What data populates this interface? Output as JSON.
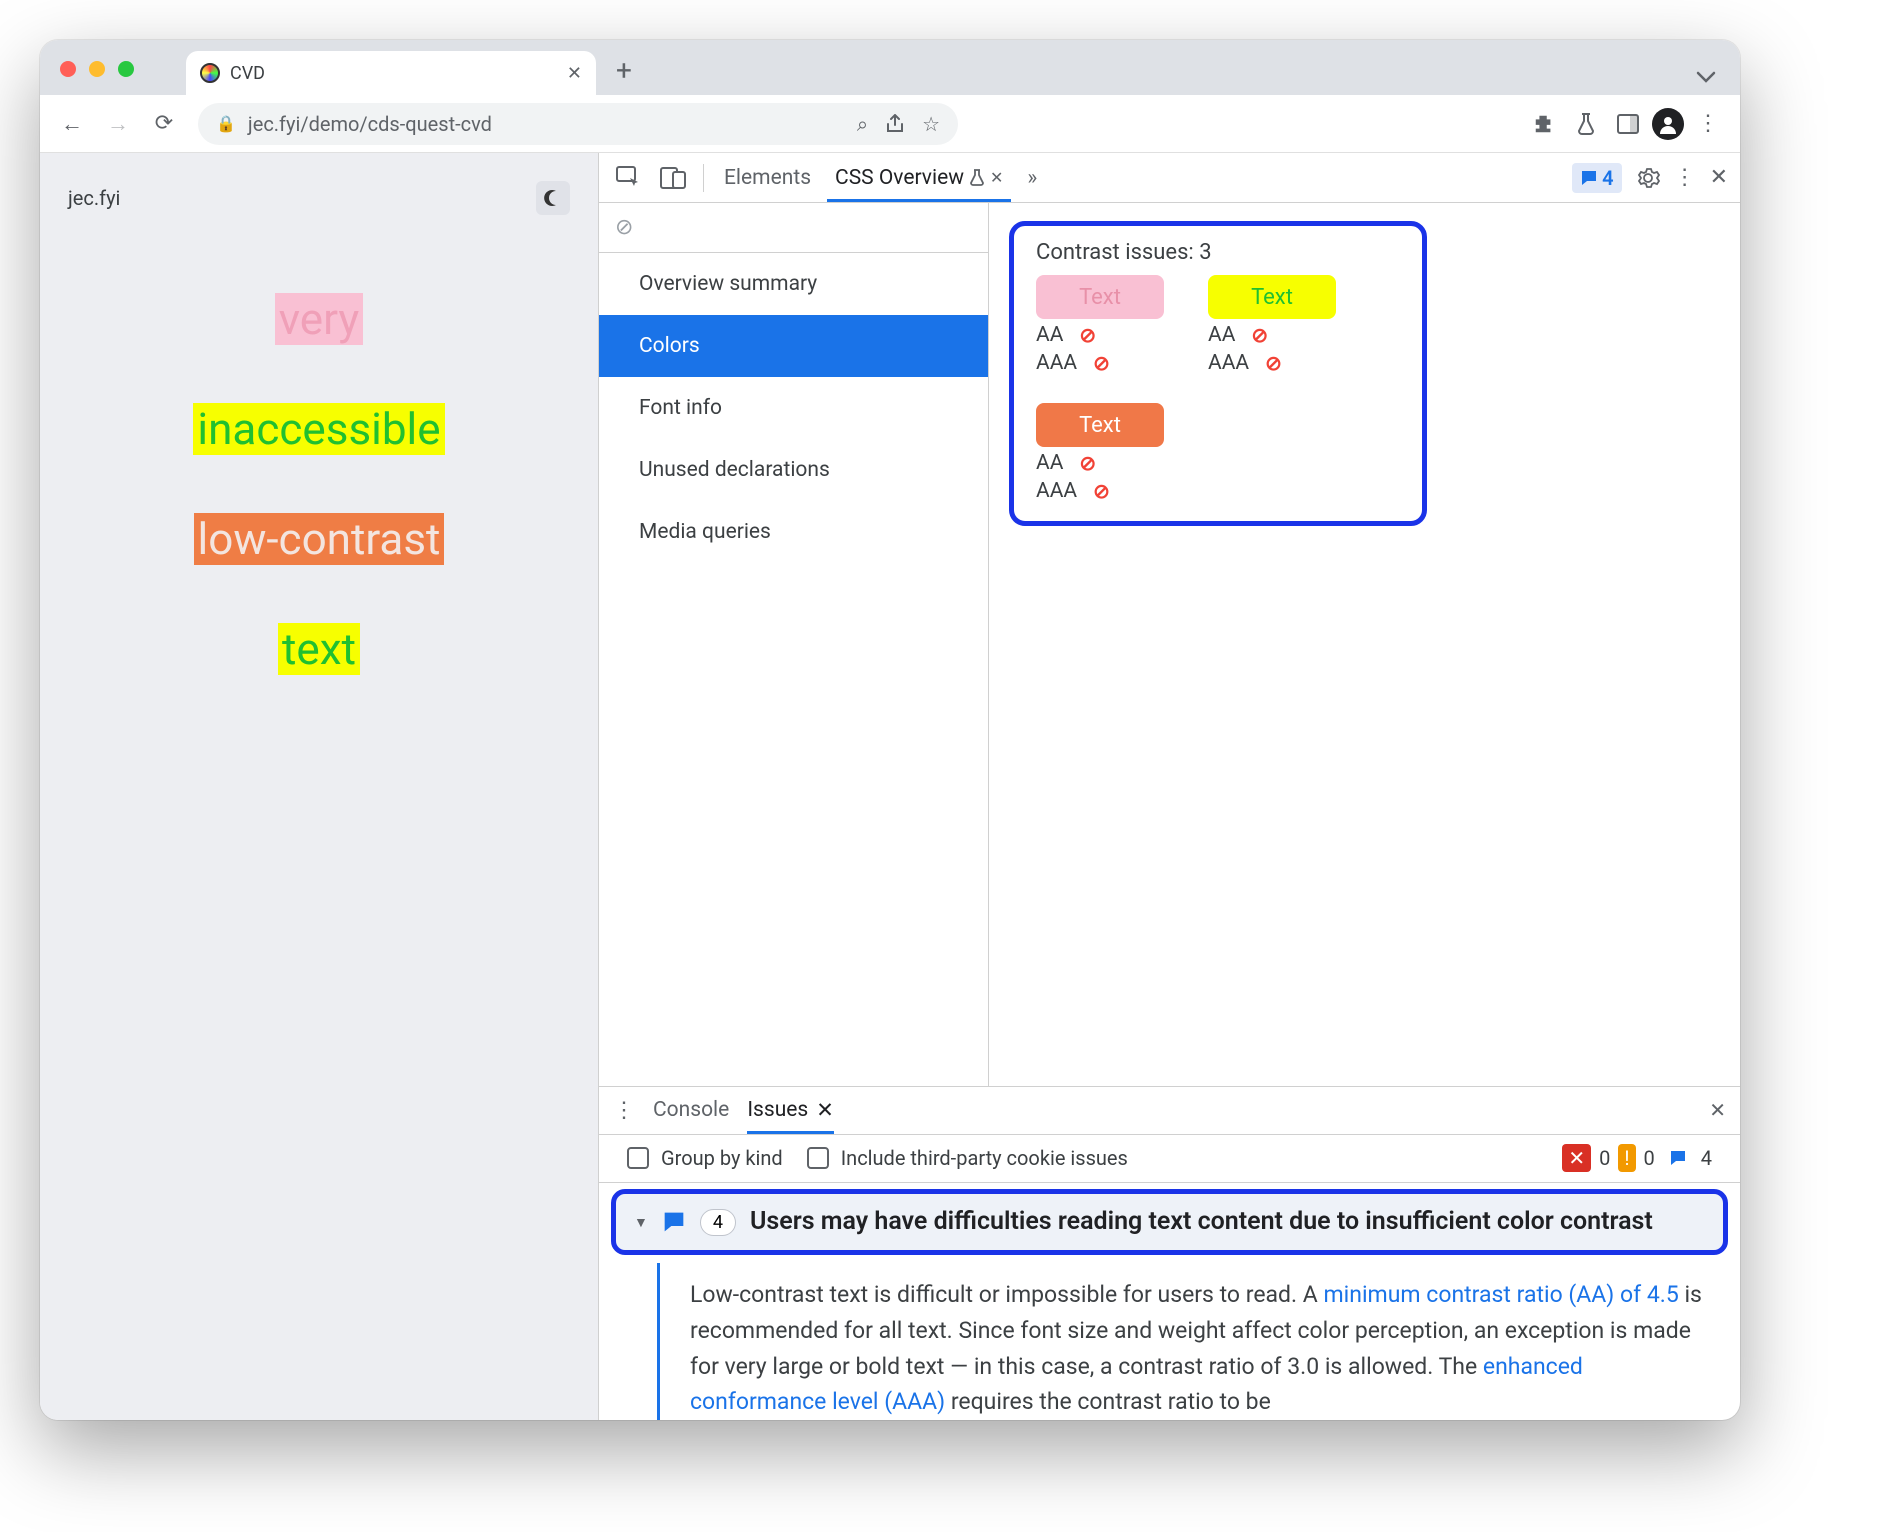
{
  "browser": {
    "tab_title": "CVD",
    "url": "jec.fyi/demo/cds-quest-cvd"
  },
  "page": {
    "site_label": "jec.fyi",
    "words": [
      {
        "text": "very",
        "fg": "#f0a0b8",
        "bg": "#f9c0d3"
      },
      {
        "text": "inaccessible",
        "fg": "#20c030",
        "bg": "#f7ff00"
      },
      {
        "text": "low-contrast",
        "fg": "#f3e5e0",
        "bg": "#ef7d45"
      },
      {
        "text": "text",
        "fg": "#20c030",
        "bg": "#f7ff00"
      }
    ]
  },
  "devtools": {
    "tabs": {
      "elements": "Elements",
      "css_overview": "CSS Overview"
    },
    "issues_count": "4",
    "nav": {
      "overview": "Overview summary",
      "colors": "Colors",
      "font": "Font info",
      "unused": "Unused declarations",
      "media": "Media queries"
    },
    "contrast": {
      "title": "Contrast issues: 3",
      "items": [
        {
          "label": "Text",
          "fg": "#e890a8",
          "bg": "#f9c0d3"
        },
        {
          "label": "Text",
          "fg": "#20c030",
          "bg": "#f7ff00"
        },
        {
          "label": "Text",
          "fg": "#ffffff",
          "bg": "#f07848"
        }
      ],
      "aa": "AA",
      "aaa": "AAA"
    }
  },
  "drawer": {
    "console": "Console",
    "issues": "Issues",
    "group_by_kind": "Group by kind",
    "include_third_party": "Include third-party cookie issues",
    "counts": {
      "error": "0",
      "warn": "0",
      "info": "4"
    },
    "issue_count": "4",
    "issue_title": "Users may have difficulties reading text content due to insufficient color contrast",
    "body_pre": "Low-contrast text is difficult or impossible for users to read. A ",
    "link1": "minimum contrast ratio (AA) of 4.5",
    "body_mid": " is recommended for all text. Since font size and weight affect color perception, an exception is made for very large or bold text — in this case, a contrast ratio of 3.0 is allowed. The ",
    "link2": "enhanced conformance level (AAA)",
    "body_post": " requires the contrast ratio to be"
  }
}
